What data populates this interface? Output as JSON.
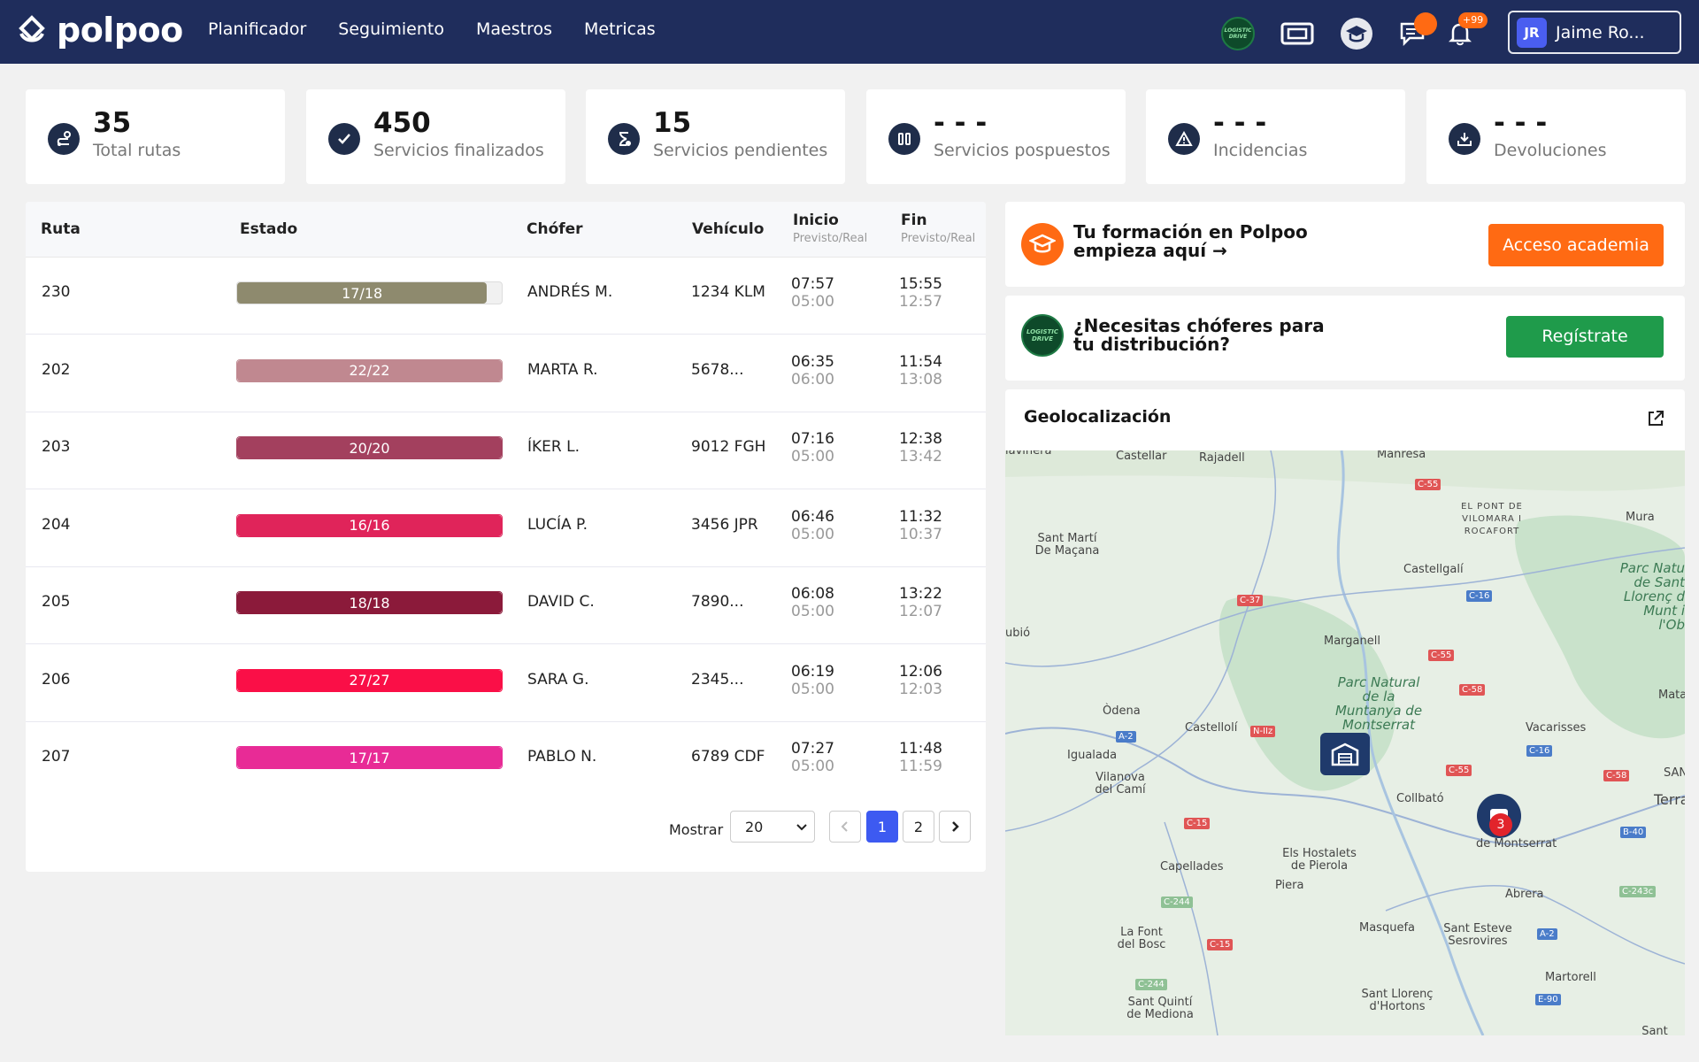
{
  "app": {
    "name": "polpoo",
    "menu": [
      "Planificador",
      "Seguimiento",
      "Maestros",
      "Metricas"
    ],
    "logistic_drive": "LOGISTIC DRIVE",
    "notification_badge": "+99",
    "user": {
      "initials": "JR",
      "name": "Jaime Ro..."
    }
  },
  "stats": [
    {
      "value": "35",
      "label": "Total rutas",
      "icon": "route-icon"
    },
    {
      "value": "450",
      "label": "Servicios finalizados",
      "icon": "check-icon"
    },
    {
      "value": "15",
      "label": "Servicios pendientes",
      "icon": "hourglass-icon"
    },
    {
      "value": "- - -",
      "label": "Servicios pospuestos",
      "icon": "pause-icon"
    },
    {
      "value": "- - -",
      "label": "Incidencias",
      "icon": "warning-icon"
    },
    {
      "value": "- - -",
      "label": "Devoluciones",
      "icon": "return-icon"
    }
  ],
  "table": {
    "headers": {
      "ruta": "Ruta",
      "estado": "Estado",
      "chofer": "Chófer",
      "vehiculo": "Vehículo",
      "inicio": "Inicio",
      "inicio_sub": "Previsto/Real",
      "fin": "Fin",
      "fin_sub": "Previsto/Real"
    },
    "rows": [
      {
        "ruta": "230",
        "estado": "17/18",
        "progress": 0.944,
        "color": "#8e8a6e",
        "chofer": "ANDRÉS M.",
        "vehiculo": "1234 KLM",
        "inicio_prev": "07:57",
        "inicio_real": "05:00",
        "fin_prev": "15:55",
        "fin_real": "12:57"
      },
      {
        "ruta": "202",
        "estado": "22/22",
        "progress": 1,
        "color": "#c08890",
        "chofer": "MARTA R.",
        "vehiculo": "5678...",
        "inicio_prev": "06:35",
        "inicio_real": "06:00",
        "fin_prev": "11:54",
        "fin_real": "13:08"
      },
      {
        "ruta": "203",
        "estado": "20/20",
        "progress": 1,
        "color": "#a3405e",
        "chofer": "ÍKER L.",
        "vehiculo": "9012 FGH",
        "inicio_prev": "07:16",
        "inicio_real": "05:00",
        "fin_prev": "12:38",
        "fin_real": "13:42"
      },
      {
        "ruta": "204",
        "estado": "16/16",
        "progress": 1,
        "color": "#e0245a",
        "chofer": "LUCÍA P.",
        "vehiculo": "3456 JPR",
        "inicio_prev": "06:46",
        "inicio_real": "05:00",
        "fin_prev": "11:32",
        "fin_real": "10:37"
      },
      {
        "ruta": "205",
        "estado": "18/18",
        "progress": 1,
        "color": "#8b1a3a",
        "chofer": "DAVID C.",
        "vehiculo": "7890...",
        "inicio_prev": "06:08",
        "inicio_real": "05:00",
        "fin_prev": "13:22",
        "fin_real": "12:07"
      },
      {
        "ruta": "206",
        "estado": "27/27",
        "progress": 1,
        "color": "#fa0f47",
        "chofer": "SARA G.",
        "vehiculo": "2345...",
        "inicio_prev": "06:19",
        "inicio_real": "05:00",
        "fin_prev": "12:06",
        "fin_real": "12:03"
      },
      {
        "ruta": "207",
        "estado": "17/17",
        "progress": 1,
        "color": "#e82b96",
        "chofer": "PABLO N.",
        "vehiculo": "6789 CDF",
        "inicio_prev": "07:27",
        "inicio_real": "05:00",
        "fin_prev": "11:48",
        "fin_real": "11:59"
      }
    ],
    "pager": {
      "label": "Mostrar",
      "page_size": "20",
      "pages": [
        "1",
        "2"
      ],
      "current": "1"
    }
  },
  "academy": {
    "title_line1": "Tu formación en Polpoo",
    "title_line2": "empieza aquí →",
    "button": "Acceso academia"
  },
  "drivers": {
    "title_line1": "¿Necesitas chóferes para",
    "title_line2": "tu distribución?",
    "button": "Regístrate"
  },
  "geo": {
    "title": "Geolocalización",
    "marker_count": "3",
    "places": {
      "lavinera": "lavinera",
      "castellar": "Castellar",
      "rajadell": "Rajadell",
      "manresa": "Manresa",
      "pont_vilomara": "EL PONT DE VILOMARA I ROCAFORT",
      "mura": "Mura",
      "sant_marti": "Sant Martí De Maçana",
      "castellgali": "Castellgalí",
      "parc_sant": "Parc Natu de Sant Llorenç d Munt i l'Ob",
      "ubio": "ubió",
      "marganell": "Marganell",
      "parc_montserrat": "Parc Natural de la Muntanya de Montserrat",
      "mata": "Mata",
      "odena": "Òdena",
      "castellolí": "Castellolí",
      "vacarisses": "Vacarisses",
      "igualada": "Igualada",
      "vilanova": "Vilanova del Camí",
      "collbato": "Collbató",
      "san": "SAN",
      "terra": "Terra",
      "monistrol": "de Montserrat",
      "els_hostalets": "Els Hostalets de Pierola",
      "capellades": "Capellades",
      "piera": "Piera",
      "abrera": "Abrera",
      "masquefa": "Masquefa",
      "sant_esteve": "Sant Esteve Sesrovires",
      "la_font": "La Font del Bosc",
      "martorell": "Martorell",
      "sant_quinti": "Sant Quintí de Mediona",
      "sant_llorenc": "Sant Llorenç d'Hortons",
      "sant_andreu": "Sant Andreu"
    },
    "roads": {
      "c55a": "C-55",
      "c37": "C-37",
      "c16a": "C-16",
      "c55b": "C-55",
      "c58a": "C-58",
      "a2a": "A-2",
      "n2": "N-IIz",
      "c16b": "C-16",
      "c55c": "C-55",
      "c58b": "C-58",
      "c15a": "C-15",
      "b40": "B-40",
      "c244a": "C-244",
      "c243": "C-243c",
      "c15b": "C-15",
      "a2b": "A-2",
      "c244b": "C-244",
      "e90": "E-90"
    }
  }
}
